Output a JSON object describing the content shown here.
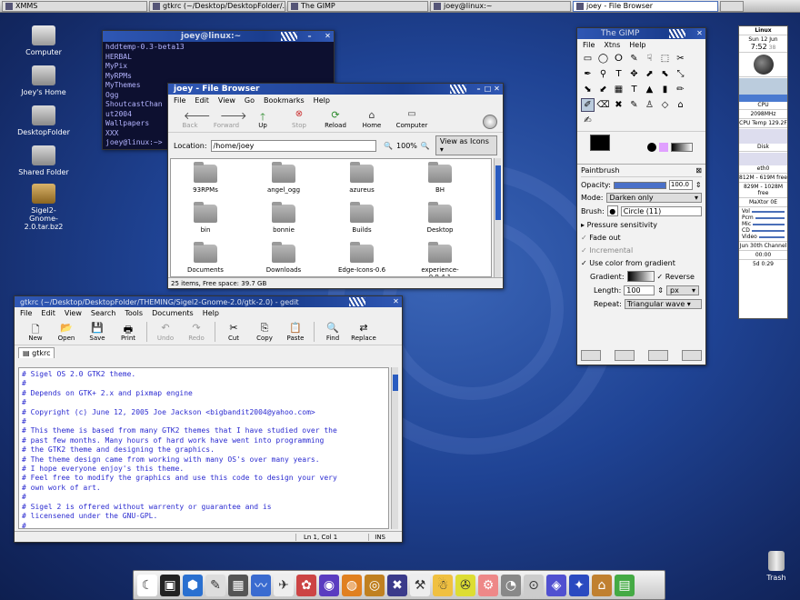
{
  "taskbar": {
    "tasks": [
      "XMMS",
      "gtkrc (~/Desktop/DesktopFolder/...",
      "The GIMP",
      "joey@linux:~",
      "joey - File Browser"
    ]
  },
  "desktop_icons": [
    "Computer",
    "Joey's Home",
    "DesktopFolder",
    "Shared Folder",
    "Sigel2-\nGnome-2.0.tar.bz2",
    "Trash"
  ],
  "terminal": {
    "title": "joey@linux:~",
    "lines": [
      "hddtemp-0.3-beta13",
      "HERBAL",
      "MyPix",
      "MyRPMs",
      "MyThemes",
      "Ogg",
      "ShoutcastChan",
      "ut2004",
      "Wallpapers",
      "XXX",
      "joey@linux:~>"
    ]
  },
  "file_browser": {
    "title": "joey - File Browser",
    "menu": [
      "File",
      "Edit",
      "View",
      "Go",
      "Bookmarks",
      "Help"
    ],
    "toolbar": [
      "Back",
      "Forward",
      "Up",
      "Stop",
      "Reload",
      "Home",
      "Computer"
    ],
    "location_label": "Location:",
    "location": "/home/joey",
    "zoom": "100%",
    "view_as": "View as Icons",
    "folders": [
      "93RPMs",
      "angel_ogg",
      "azureus",
      "BH",
      "bin",
      "bonnie",
      "Builds",
      "Desktop",
      "Documents",
      "Downloads",
      "Edge-Icons-0.6",
      "experience-0.9.4.1"
    ],
    "status": "25 items, Free space: 39.7 GB"
  },
  "gedit": {
    "title": "gtkrc (~/Desktop/DesktopFolder/THEMING/Sigel2-Gnome-2.0/gtk-2.0) - gedit",
    "menu": [
      "File",
      "Edit",
      "View",
      "Search",
      "Tools",
      "Documents",
      "Help"
    ],
    "toolbar": [
      "New",
      "Open",
      "Save",
      "Print",
      "Undo",
      "Redo",
      "Cut",
      "Copy",
      "Paste",
      "Find",
      "Replace"
    ],
    "tab": "gtkrc",
    "lines": [
      "# Sigel OS 2.0 GTK2 theme.",
      "#",
      "# Depends on GTK+ 2.x and pixmap engine",
      "#",
      "# Copyright (c) June 12, 2005 Joe Jackson <bigbandit2004@yahoo.com>",
      "#",
      "# This theme is based from many GTK2 themes that I have studied over the",
      "# past few months. Many hours of hard work have went into programming",
      "# the GTK2 theme and designing the graphics.",
      "# The theme design came from working with many OS's over many years.",
      "# I hope everyone enjoy's this theme.",
      "# Feel free to modify the graphics and use this code to design your very",
      "# own work of art.",
      "#",
      "# Sigel 2 is offered without warrenty or guarantee and is",
      "# licensened under the GNU-GPL.",
      "#"
    ],
    "position": "Ln 1, Col 1",
    "mode": "INS"
  },
  "gimp": {
    "title": "The GIMP",
    "menu": [
      "File",
      "Xtns",
      "Help"
    ],
    "tools": [
      "▭",
      "◯",
      "ⵔ",
      "✎",
      "☟",
      "⬚",
      "✂",
      "✒",
      "⚲",
      "T",
      "✥",
      "⬈",
      "⬉",
      "⤡",
      "⬊",
      "⬋",
      "▦",
      "T",
      "▲",
      "▮",
      "✏",
      "✐",
      "⌫",
      "✖",
      "✎",
      "♙",
      "◇",
      "⌂",
      "✍"
    ],
    "options_title": "Paintbrush",
    "opacity_label": "Opacity:",
    "opacity": "100.0",
    "opacity_fraction": 1.0,
    "mode_label": "Mode:",
    "mode": "Darken only",
    "brush_label": "Brush:",
    "brush": "Circle (11)",
    "pressure": "Pressure sensitivity",
    "fade": "Fade out",
    "incremental": "Incremental",
    "use_gradient": "Use color from gradient",
    "gradient_label": "Gradient:",
    "reverse": "Reverse",
    "length_label": "Length:",
    "length": "100",
    "length_unit": "px",
    "repeat_label": "Repeat:",
    "repeat": "Triangular wave"
  },
  "monitor": {
    "os": "Linux",
    "date": "Sun 12 Jun",
    "time": "7:52",
    "seconds": "38",
    "cpu_label": "CPU",
    "cpu_freq": "2098MHz",
    "cpu_temp_label": "CPU Temp",
    "cpu_temp": "129.2F",
    "disk_label": "Disk",
    "eth": "eth0",
    "mem1": "812M - 619M free",
    "mem2": "829M - 1028M free",
    "mixer": "MaXtor",
    "mixer_val": "0E",
    "vol_labels": [
      "Vol",
      "Pcm",
      "Mic",
      "CD",
      "Video"
    ],
    "channel": "Jun 30th Channel",
    "timer1": "00:00",
    "timer2": "5d 0:29"
  },
  "colors": {
    "accent": "#1f3f93",
    "link_text": "#2b2bd0"
  }
}
